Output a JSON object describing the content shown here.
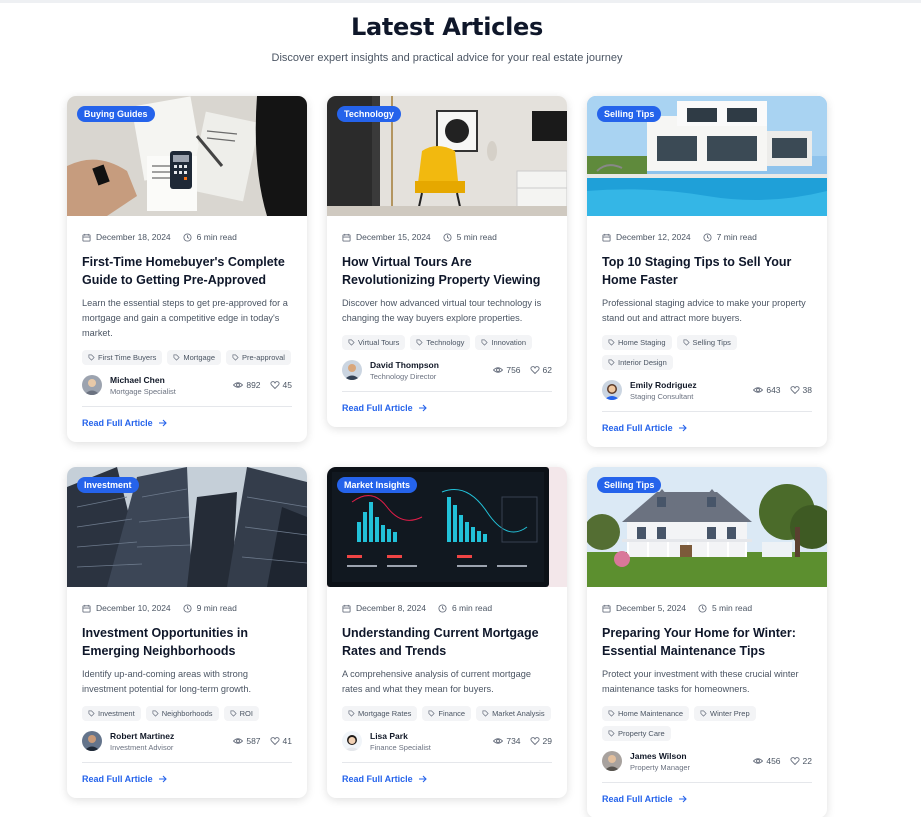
{
  "header": {
    "title": "Latest Articles",
    "subtitle": "Discover expert insights and practical advice for your real estate journey"
  },
  "colors": {
    "accent": "#2563eb",
    "text": "#0f172a",
    "muted": "#4b5563",
    "tag_bg": "#f3f4f6"
  },
  "articles": [
    {
      "category": "Buying Guides",
      "date": "December 18, 2024",
      "read_time": "6 min read",
      "title": "First-Time Homebuyer's Complete Guide to Getting Pre-Approved",
      "excerpt": "Learn the essential steps to get pre-approved for a mortgage and gain a competitive edge in today's market.",
      "tags": [
        "First Time Buyers",
        "Mortgage",
        "Pre-approval"
      ],
      "author": "Michael Chen",
      "role": "Mortgage Specialist",
      "views": "892",
      "likes": "45",
      "read_more": "Read Full Article",
      "image_icon": "documents-calculator-photo"
    },
    {
      "category": "Technology",
      "date": "December 15, 2024",
      "read_time": "5 min read",
      "title": "How Virtual Tours Are Revolutionizing Property Viewing",
      "excerpt": "Discover how advanced virtual tour technology is changing the way buyers explore properties.",
      "tags": [
        "Virtual Tours",
        "Technology",
        "Innovation"
      ],
      "author": "David Thompson",
      "role": "Technology Director",
      "views": "756",
      "likes": "62",
      "read_more": "Read Full Article",
      "image_icon": "yellow-chair-interior-photo"
    },
    {
      "category": "Selling Tips",
      "date": "December 12, 2024",
      "read_time": "7 min read",
      "title": "Top 10 Staging Tips to Sell Your Home Faster",
      "excerpt": "Professional staging advice to make your property stand out and attract more buyers.",
      "tags": [
        "Home Staging",
        "Selling Tips",
        "Interior Design"
      ],
      "author": "Emily Rodriguez",
      "role": "Staging Consultant",
      "views": "643",
      "likes": "38",
      "read_more": "Read Full Article",
      "image_icon": "modern-villa-pool-photo"
    },
    {
      "category": "Investment",
      "date": "December 10, 2024",
      "read_time": "9 min read",
      "title": "Investment Opportunities in Emerging Neighborhoods",
      "excerpt": "Identify up-and-coming areas with strong investment potential for long-term growth.",
      "tags": [
        "Investment",
        "Neighborhoods",
        "ROI"
      ],
      "author": "Robert Martinez",
      "role": "Investment Advisor",
      "views": "587",
      "likes": "41",
      "read_more": "Read Full Article",
      "image_icon": "skyscrapers-photo"
    },
    {
      "category": "Market Insights",
      "date": "December 8, 2024",
      "read_time": "6 min read",
      "title": "Understanding Current Mortgage Rates and Trends",
      "excerpt": "A comprehensive analysis of current mortgage rates and what they mean for buyers.",
      "tags": [
        "Mortgage Rates",
        "Finance",
        "Market Analysis"
      ],
      "author": "Lisa Park",
      "role": "Finance Specialist",
      "views": "734",
      "likes": "29",
      "read_more": "Read Full Article",
      "image_icon": "trading-screen-photo"
    },
    {
      "category": "Selling Tips",
      "date": "December 5, 2024",
      "read_time": "5 min read",
      "title": "Preparing Your Home for Winter: Essential Maintenance Tips",
      "excerpt": "Protect your investment with these crucial winter maintenance tasks for homeowners.",
      "tags": [
        "Home Maintenance",
        "Winter Prep",
        "Property Care"
      ],
      "author": "James Wilson",
      "role": "Property Manager",
      "views": "456",
      "likes": "22",
      "read_more": "Read Full Article",
      "image_icon": "colonial-house-photo"
    }
  ]
}
